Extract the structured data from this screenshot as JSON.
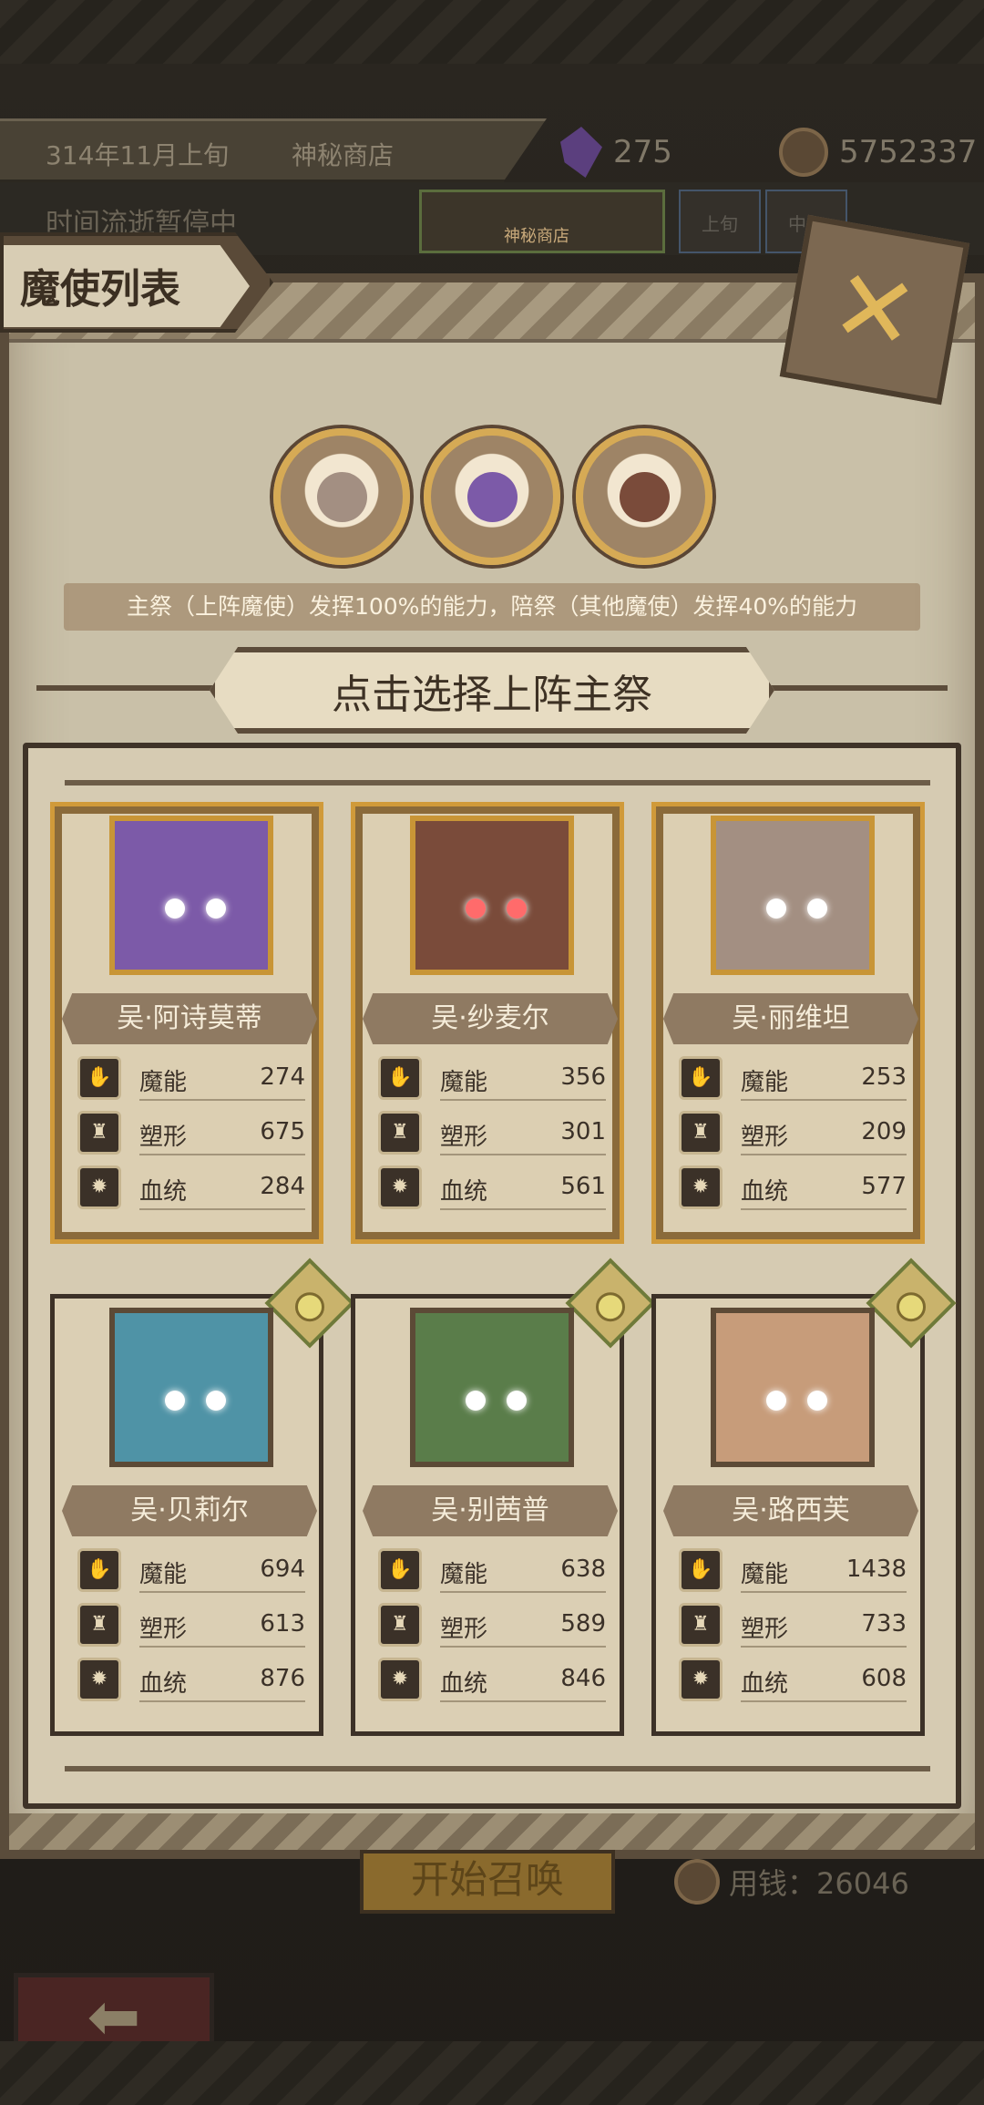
{
  "header": {
    "date": "314年11月上旬",
    "location": "神秘商店",
    "crystal_count": "275",
    "gold_count": "5752337",
    "time_status": "时间流逝暂停中",
    "mini_shop_label": "神秘商店",
    "mini_tabs": [
      "上旬",
      "中旬"
    ]
  },
  "panel": {
    "title": "魔使列表",
    "close_icon": "close-x-icon",
    "note": "主祭（上阵魔使）发挥100%的能力，陪祭（其他魔使）发挥40%的能力",
    "choose_prompt": "点击选择上阵主祭"
  },
  "team_slots": [
    "selected-envoy-1",
    "selected-envoy-2",
    "selected-envoy-3"
  ],
  "stat_labels": {
    "magic": "魔能",
    "shape": "塑形",
    "blood": "血统"
  },
  "cards": [
    {
      "name": "吴·阿诗莫蒂",
      "magic": "274",
      "shape": "675",
      "blood": "284",
      "selected": true,
      "accent": "#7c5aa8"
    },
    {
      "name": "吴·纱麦尔",
      "magic": "356",
      "shape": "301",
      "blood": "561",
      "selected": true,
      "accent": "#7a4b3a"
    },
    {
      "name": "吴·丽维坦",
      "magic": "253",
      "shape": "209",
      "blood": "577",
      "selected": true,
      "accent": "#a38f82"
    },
    {
      "name": "吴·贝莉尔",
      "magic": "694",
      "shape": "613",
      "blood": "876",
      "selected": false,
      "accent": "#4f93a6"
    },
    {
      "name": "吴·别茜普",
      "magic": "638",
      "shape": "589",
      "blood": "846",
      "selected": false,
      "accent": "#5a7d4a"
    },
    {
      "name": "吴·路西芙",
      "magic": "1438",
      "shape": "733",
      "blood": "608",
      "selected": false,
      "accent": "#c79c7a"
    }
  ],
  "footer": {
    "summon_label": "开始召唤",
    "cost_text": "用钱：26046"
  }
}
